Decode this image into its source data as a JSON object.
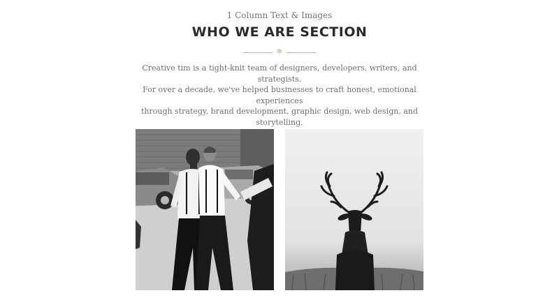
{
  "section": {
    "eyebrow": "1 Column Text & Images",
    "title": "WHO WE ARE SECTION",
    "divider_icon": "asterisk-icon",
    "description_lines": [
      "Creative tim is a tight-knit team of designers, developers, writers, and strategists.",
      "For over a decade, we've helped businesses to craft honest, emotional experiences",
      "through strategy, brand development, graphic design, web design, and storytelling."
    ]
  },
  "images": [
    {
      "subject": "men-walking-photo",
      "style": "black-and-white"
    },
    {
      "subject": "deer-photo",
      "style": "black-and-white"
    }
  ],
  "colors": {
    "accent": "#c9b48a",
    "title": "#2b2b2b",
    "body_text": "#6f6f6f",
    "eyebrow_text": "#777777",
    "background": "#ffffff"
  }
}
